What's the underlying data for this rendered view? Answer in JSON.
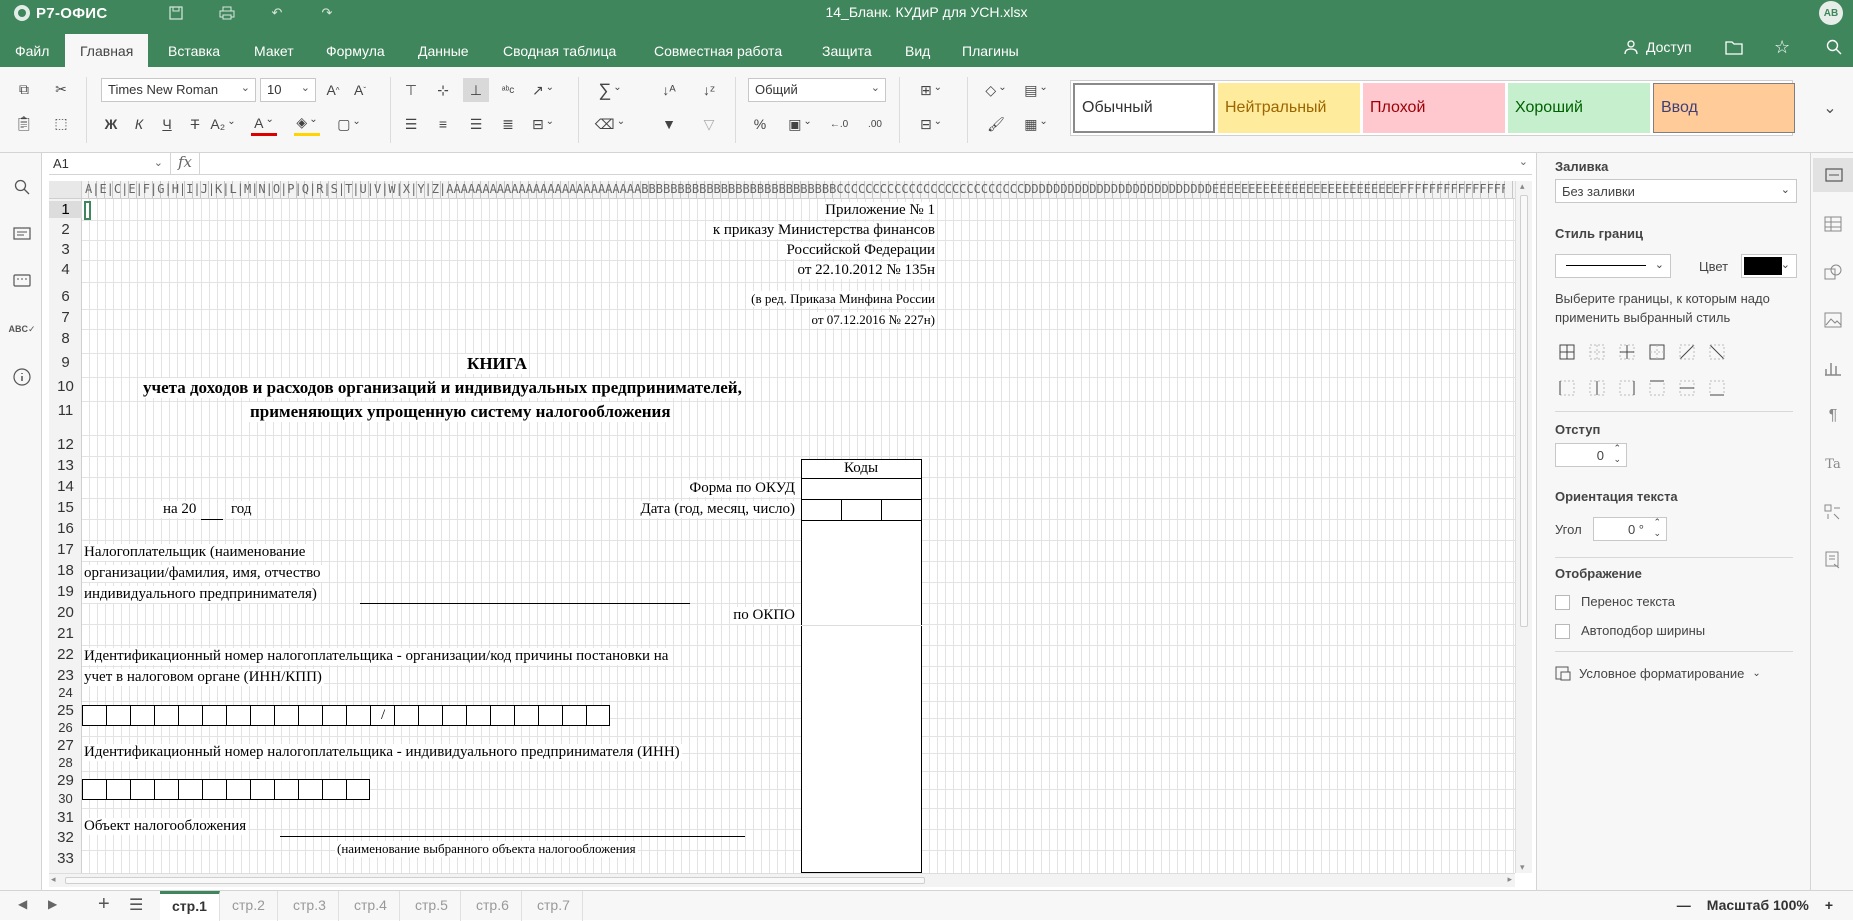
{
  "app": {
    "logo": "Р7-ОФИС",
    "doc_title": "14_Бланк. КУДиР для УСН.xlsx",
    "avatar": "АВ",
    "accent": "#40865c"
  },
  "menu": {
    "tabs": [
      "Файл",
      "Главная",
      "Вставка",
      "Макет",
      "Формула",
      "Данные",
      "Сводная таблица",
      "Совместная работа",
      "Защита",
      "Вид",
      "Плагины"
    ],
    "active_tab": "Главная",
    "access_label": "Доступ"
  },
  "toolbar": {
    "font_name": "Times New Roman",
    "font_size": "10",
    "bold": "Ж",
    "italic": "К",
    "underline": "Ч",
    "strike": "Т",
    "number_format": "Общий",
    "percent": "%",
    "sum": "∑"
  },
  "styles": [
    {
      "label": "Обычный",
      "bg": "#ffffff",
      "color": "#000000"
    },
    {
      "label": "Нейтральный",
      "bg": "#ffeb9c",
      "color": "#9c6500"
    },
    {
      "label": "Плохой",
      "bg": "#ffc7ce",
      "color": "#9c0006"
    },
    {
      "label": "Хороший",
      "bg": "#c6efce",
      "color": "#006100"
    },
    {
      "label": "Ввод",
      "bg": "#ffcc99",
      "color": "#3f3f76"
    }
  ],
  "formula_bar": {
    "cell_ref": "A1",
    "fx": "fx"
  },
  "sheet": {
    "col_header_text": "A|E|C|E|F|G|H|I|J|K|L|M|N|O|P|Q|R|S|T|U|V|W|X|Y|Z|AAAAAAAAAAAAAAAAAAAAAAAAAAABBBBBBBBBBBBBBBBBBBBBBBBBBBCCCCCCCCCCCCCCCCCCCCCCCCCCDDDDDDDDDDDDDDDDDDDDDDDDDDEEEEEEEEEEEEEEEEEEEEEEEEEEFFFFFFFFFFFFFFFFFFFF",
    "row_numbers": [
      "1",
      "2",
      "3",
      "4",
      "6",
      "7",
      "8",
      "9",
      "10",
      "11",
      "12",
      "13",
      "14",
      "15",
      "16",
      "17",
      "18",
      "19",
      "20",
      "21",
      "22",
      "23",
      "24",
      "25",
      "26",
      "27",
      "28",
      "29",
      "30",
      "31",
      "32",
      "33"
    ],
    "cells": {
      "app1": "Приложение № 1",
      "app2": "к приказу Министерства финансов",
      "app3": "Российской Федерации",
      "app4": "от 22.10.2012 № 135н",
      "app6": "(в ред. Приказа Минфина России",
      "app7": "от 07.12.2016 № 227н)",
      "title1": "КНИГА",
      "title2": "учета доходов и расходов организаций и индивидуальных предпринимателей,",
      "title3": "применяющих упрощенную систему налогообложения",
      "codes": "Коды",
      "okud": "Форма по ОКУД",
      "year_pre": "на 20",
      "year_post": "год",
      "date": "Дата (год, месяц, число)",
      "tp1": "Налогоплательщик (наименование",
      "tp2": "организации/фамилия, имя, отчество",
      "tp3": "индивидуального предпринимателя)",
      "okpo": "по ОКПО",
      "inn1": "Идентификационный номер налогоплательщика - организации/код причины постановки на",
      "inn2": "учет в налоговом органе (ИНН/КПП)",
      "slash": "/",
      "inn3": "Идентификационный номер налогоплательщика - индивидуального предпринимателя (ИНН)",
      "obj": "Объект налогообложения",
      "obj_note": "(наименование выбранного объекта налогообложения"
    }
  },
  "right_panel": {
    "fill_label": "Заливка",
    "fill_value": "Без заливки",
    "border_style_label": "Стиль границ",
    "color_label": "Цвет",
    "border_color": "#000000",
    "border_hint": "Выберите границы, к которым надо применить выбранный стиль",
    "indent_label": "Отступ",
    "indent_value": "0",
    "orientation_label": "Ориентация текста",
    "angle_label": "Угол",
    "angle_value": "0 °",
    "display_label": "Отображение",
    "wrap_label": "Перенос текста",
    "autofit_label": "Автоподбор ширины",
    "cond_format_label": "Условное форматирование"
  },
  "sheet_tabs": [
    "стр.1",
    "стр.2",
    "стр.3",
    "стр.4",
    "стр.5",
    "стр.6",
    "стр.7"
  ],
  "active_sheet": "стр.1",
  "zoom_label": "Масштаб 100%"
}
